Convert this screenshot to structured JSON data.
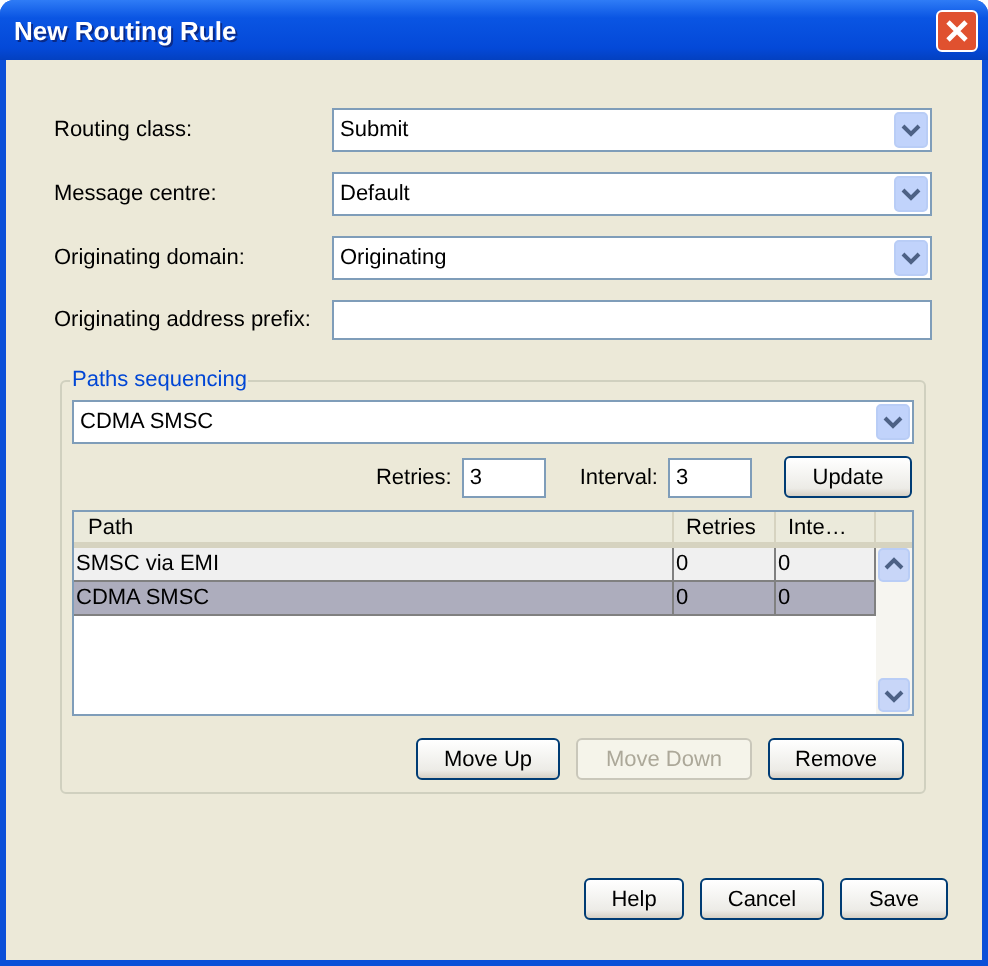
{
  "window": {
    "title": "New Routing Rule"
  },
  "form": [
    {
      "kind": "combo",
      "label": "Routing class:",
      "value": "Submit"
    },
    {
      "kind": "combo",
      "label": "Message centre:",
      "value": "Default"
    },
    {
      "kind": "combo",
      "label": "Originating domain:",
      "value": "Originating"
    },
    {
      "kind": "text",
      "label": "Originating address prefix:"
    }
  ],
  "paths_sequencing": {
    "title": "Paths sequencing",
    "path_select": "CDMA SMSC",
    "retries": {
      "label": "Retries:",
      "value": "3"
    },
    "interval": {
      "label": "Interval:",
      "value": "3"
    },
    "update_button": "Update",
    "table": {
      "columns": [
        "Path",
        "Retries",
        "Inte…"
      ],
      "rows": [
        {
          "cells": [
            "SMSC via EMI",
            "0",
            "0"
          ],
          "selected": false
        },
        {
          "cells": [
            "CDMA SMSC",
            "0",
            "0"
          ],
          "selected": true
        }
      ]
    },
    "buttons": [
      {
        "label": "Move Up",
        "disabled": false
      },
      {
        "label": "Move Down",
        "disabled": true
      },
      {
        "label": "Remove",
        "disabled": false
      }
    ]
  },
  "buttons": [
    {
      "label": "Help"
    },
    {
      "label": "Cancel"
    },
    {
      "label": "Save"
    }
  ]
}
